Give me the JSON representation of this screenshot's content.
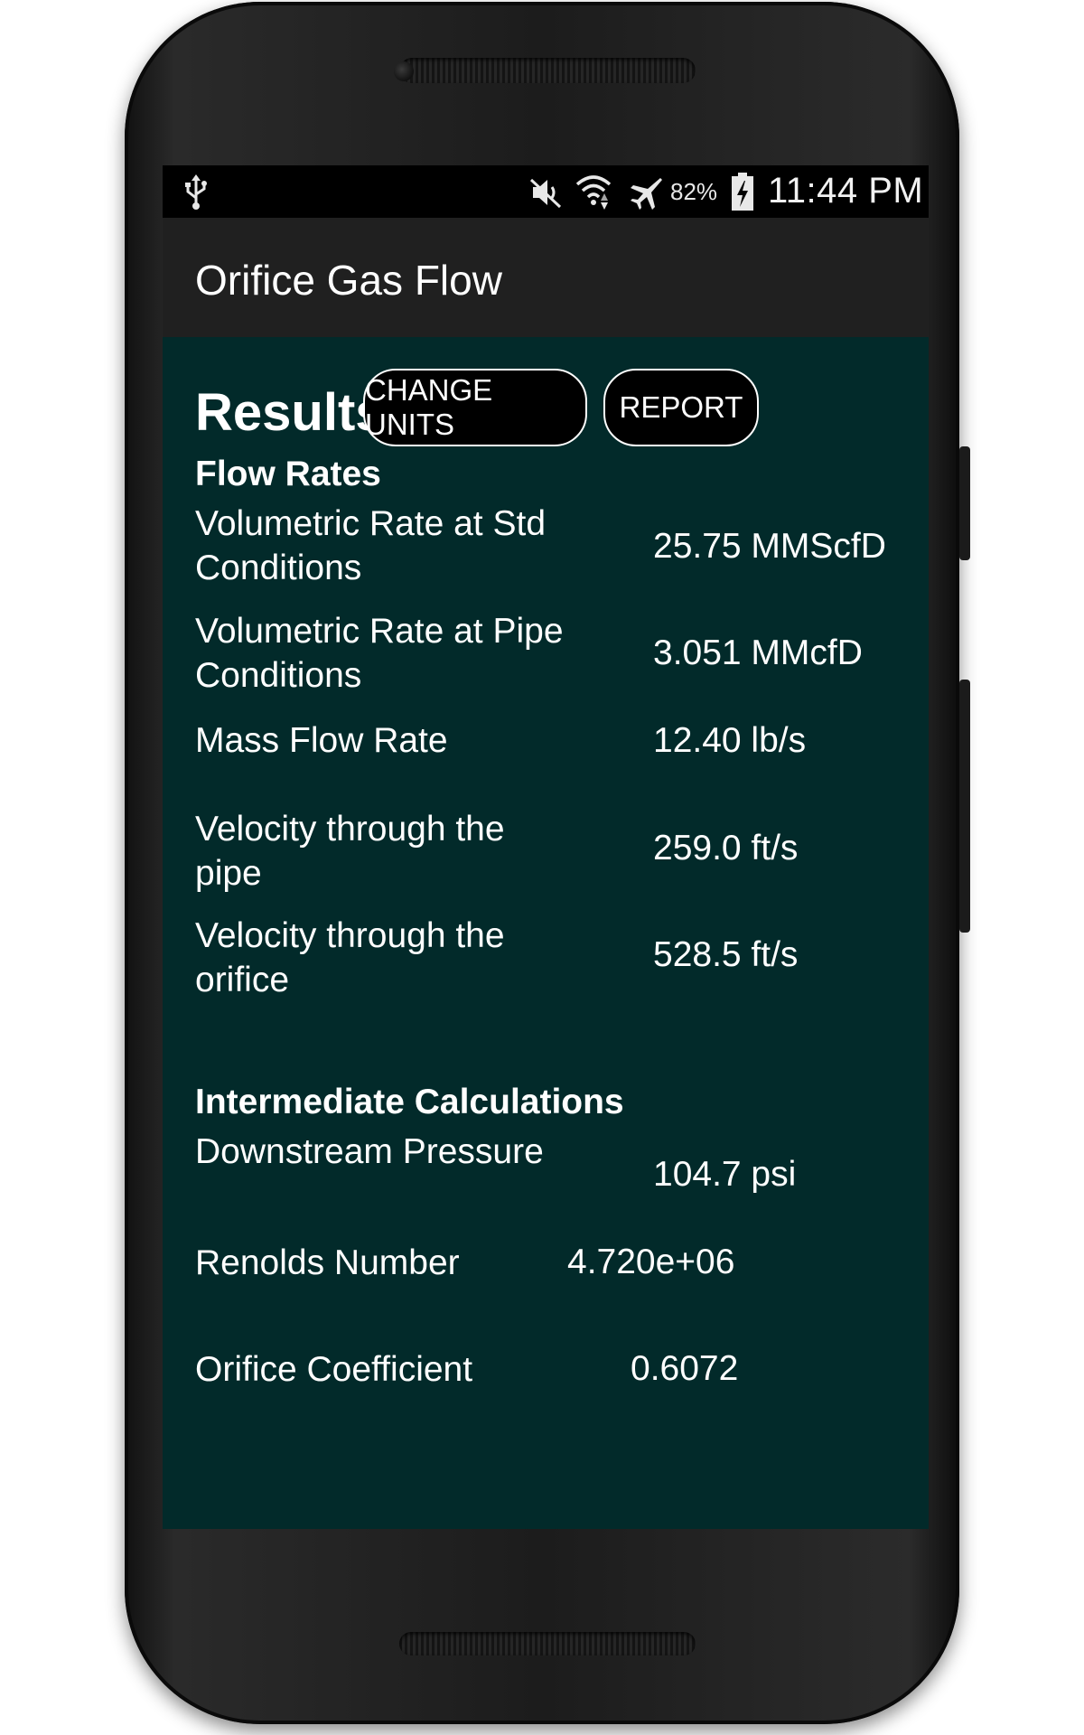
{
  "status_bar": {
    "battery_percent": "82%",
    "time": "11:44 PM",
    "icons": [
      "usb-icon",
      "mute-icon",
      "wifi-icon",
      "airplane-icon",
      "battery-charging-icon"
    ]
  },
  "app_bar": {
    "title": "Orifice Gas Flow"
  },
  "results": {
    "title": "Results",
    "change_units_label": "CHANGE UNITS",
    "report_label": "REPORT"
  },
  "flow_rates": {
    "heading": "Flow Rates",
    "rows": [
      {
        "label": "Volumetric Rate at Std Conditions",
        "value": "25.75 MMScfD"
      },
      {
        "label": "Volumetric Rate at Pipe Conditions",
        "value": "3.051 MMcfD"
      },
      {
        "label": "Mass Flow Rate",
        "value": "12.40 lb/s"
      },
      {
        "label": "Velocity through the pipe",
        "value": "259.0 ft/s"
      },
      {
        "label": "Velocity through the orifice",
        "value": "528.5 ft/s"
      }
    ]
  },
  "intermediate": {
    "heading": "Intermediate Calculations",
    "rows": [
      {
        "label": "Downstream Pressure",
        "value": "104.7 psi"
      },
      {
        "label": "Renolds Number",
        "value": "4.720e+06"
      },
      {
        "label": "Orifice Coefficient",
        "value": "0.6072"
      }
    ]
  },
  "colors": {
    "content_bg": "#022a2a",
    "app_bar_bg": "#202020",
    "status_bar_bg": "#000000",
    "text": "#ffffff"
  }
}
